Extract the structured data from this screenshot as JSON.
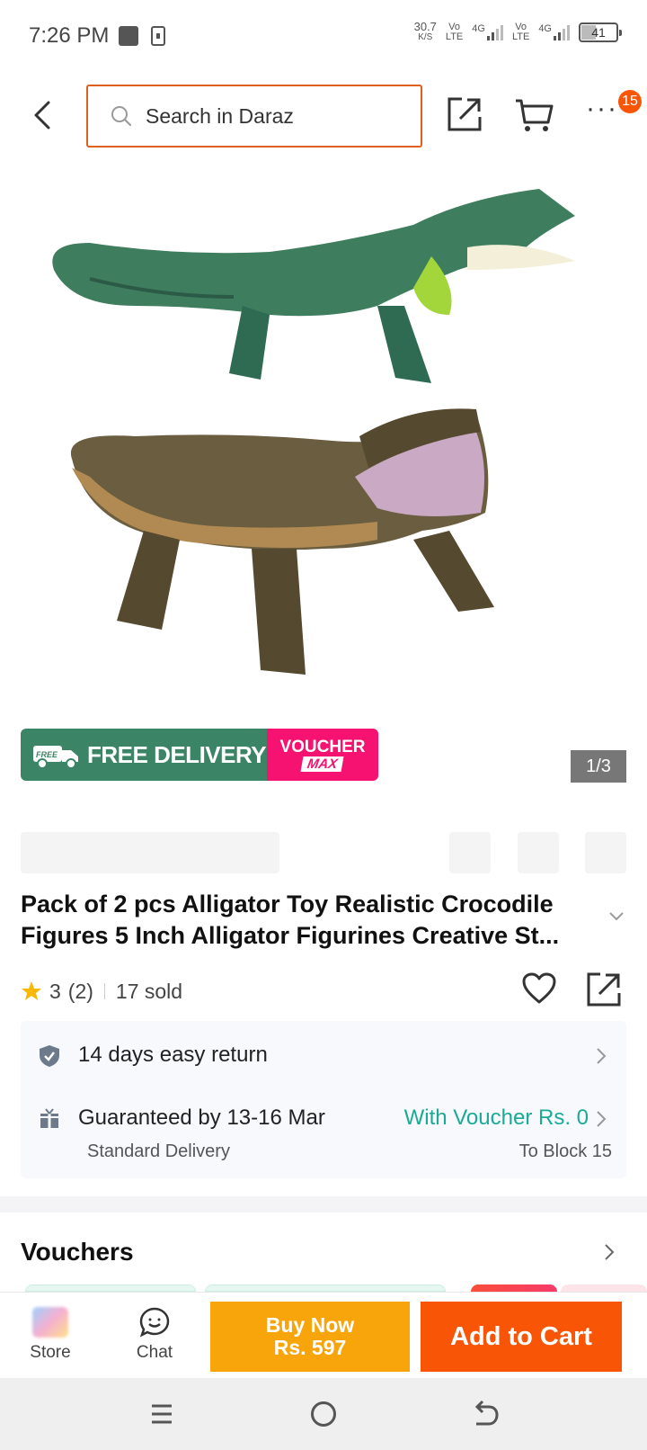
{
  "status_bar": {
    "time": "7:26 PM",
    "speed_value": "30.7",
    "speed_unit": "K/S",
    "sim1_top": "Vo",
    "sim1_bottom": "LTE",
    "sim1_net": "4G",
    "sim2_top": "Vo",
    "sim2_bottom": "LTE",
    "sim2_net": "4G",
    "battery": "41"
  },
  "header": {
    "search_placeholder": "Search in Daraz",
    "cart_badge": "15",
    "more_label": "···"
  },
  "gallery": {
    "promo_free_delivery": "FREE DELIVERY",
    "promo_voucher": "VOUCHER",
    "promo_max": "MAX",
    "promo_badge_free": "FREE",
    "page_indicator": "1/3"
  },
  "product": {
    "title": "Pack of 2 pcs Alligator Toy Realistic Crocodile Figures 5 Inch Alligator Figurines Creative St...",
    "rating": "3",
    "review_count": "(2)",
    "sold": "17 sold"
  },
  "info": {
    "return_policy": "14 days easy return",
    "guarantee": "Guaranteed by 13-16 Mar",
    "voucher_price": "With Voucher Rs. 0",
    "delivery_type": "Standard Delivery",
    "delivery_location": "To Block 15"
  },
  "vouchers": {
    "title": "Vouchers"
  },
  "action_bar": {
    "store_label": "Store",
    "chat_label": "Chat",
    "buy_now_label": "Buy Now",
    "buy_now_price": "Rs. 597",
    "add_to_cart_label": "Add to Cart"
  },
  "colors": {
    "brand_orange": "#f85606",
    "buy_now": "#f8a50c",
    "search_border": "#e0601f",
    "free_delivery_green": "#3b8466",
    "voucher_pink": "#f51270",
    "voucher_text_teal": "#1aaa96"
  },
  "icons": {
    "back": "chevron-left-icon",
    "search": "search-icon",
    "share": "share-icon",
    "cart": "cart-icon",
    "more": "more-dots-icon",
    "star": "star-icon",
    "heart": "heart-icon",
    "shield": "shield-check-icon",
    "gift": "gift-icon",
    "chat": "chat-icon"
  }
}
